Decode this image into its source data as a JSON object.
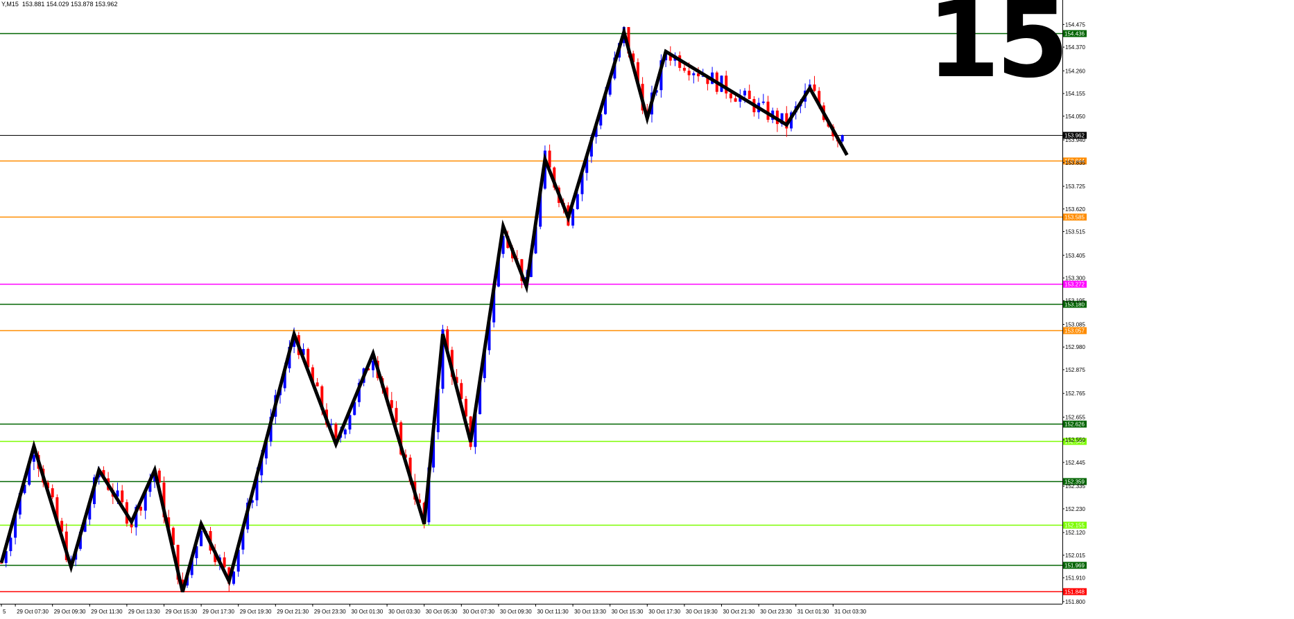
{
  "header": {
    "symbol_timeframe": "Y,M15",
    "ohlc": "153.881 154.029 153.878 153.962"
  },
  "overlay_number": "15",
  "chart_data": {
    "type": "candlestick",
    "title": "",
    "xlabel": "",
    "ylabel": "",
    "ylim": [
      151.79,
      154.55
    ],
    "grid": false,
    "colors": {
      "up": "#0000ff",
      "down": "#ff0000",
      "background": "#ffffff",
      "axis": "#000000",
      "zigzag": "#000000"
    },
    "y_ticks": [
      "154.475",
      "154.370",
      "154.260",
      "154.155",
      "154.050",
      "153.940",
      "153.835",
      "153.725",
      "153.620",
      "153.515",
      "153.405",
      "153.300",
      "153.195",
      "153.085",
      "152.980",
      "152.875",
      "152.765",
      "152.655",
      "152.550",
      "152.445",
      "152.335",
      "152.230",
      "152.120",
      "152.015",
      "151.910",
      "151.800"
    ],
    "x_ticks": [
      "5",
      "29 Oct 07:30",
      "29 Oct 09:30",
      "29 Oct 11:30",
      "29 Oct 13:30",
      "29 Oct 15:30",
      "29 Oct 17:30",
      "29 Oct 19:30",
      "29 Oct 21:30",
      "29 Oct 23:30",
      "30 Oct 01:30",
      "30 Oct 03:30",
      "30 Oct 05:30",
      "30 Oct 07:30",
      "30 Oct 09:30",
      "30 Oct 11:30",
      "30 Oct 13:30",
      "30 Oct 15:30",
      "30 Oct 17:30",
      "30 Oct 19:30",
      "30 Oct 21:30",
      "30 Oct 23:30",
      "31 Oct 01:30",
      "31 Oct 03:30"
    ],
    "x_tick_index": [
      0,
      3,
      11,
      19,
      27,
      35,
      43,
      51,
      59,
      67,
      75,
      83,
      91,
      99,
      107,
      115,
      123,
      131,
      139,
      147,
      155,
      163,
      171,
      179
    ],
    "current_price": {
      "value": 153.962,
      "label": "153.962",
      "color": "#000000",
      "line_color": "#000000"
    },
    "horizontal_levels": [
      {
        "value": 154.436,
        "label": "154.436",
        "color": "#006400"
      },
      {
        "value": 153.844,
        "label": "153.844",
        "color": "#ff8c00"
      },
      {
        "value": 153.585,
        "label": "153.585",
        "color": "#ff8c00"
      },
      {
        "value": 153.272,
        "label": "153.272",
        "color": "#ff00ff"
      },
      {
        "value": 153.18,
        "label": "153.180",
        "color": "#006400"
      },
      {
        "value": 153.057,
        "label": "153.057",
        "color": "#ff8c00"
      },
      {
        "value": 152.626,
        "label": "152.626",
        "color": "#006400"
      },
      {
        "value": 152.545,
        "label": "152.545",
        "color": "#7cfc00"
      },
      {
        "value": 152.359,
        "label": "152.359",
        "color": "#006400"
      },
      {
        "value": 152.155,
        "label": "152.155",
        "color": "#7cfc00"
      },
      {
        "value": 151.969,
        "label": "151.969",
        "color": "#006400"
      },
      {
        "value": 151.848,
        "label": "151.848",
        "color": "#ff0000"
      }
    ],
    "zigzag": [
      {
        "i": 0,
        "price": 151.98
      },
      {
        "i": 7,
        "price": 152.52
      },
      {
        "i": 15,
        "price": 151.96
      },
      {
        "i": 21,
        "price": 152.41
      },
      {
        "i": 28,
        "price": 152.17
      },
      {
        "i": 33,
        "price": 152.41
      },
      {
        "i": 39,
        "price": 151.845
      },
      {
        "i": 43,
        "price": 152.16
      },
      {
        "i": 49,
        "price": 151.895
      },
      {
        "i": 63,
        "price": 153.04
      },
      {
        "i": 72,
        "price": 152.53
      },
      {
        "i": 80,
        "price": 152.95
      },
      {
        "i": 91,
        "price": 152.16
      },
      {
        "i": 95,
        "price": 153.04
      },
      {
        "i": 101,
        "price": 152.54
      },
      {
        "i": 108,
        "price": 153.54
      },
      {
        "i": 113,
        "price": 153.26
      },
      {
        "i": 117,
        "price": 153.85
      },
      {
        "i": 122,
        "price": 153.58
      },
      {
        "i": 134,
        "price": 154.44
      },
      {
        "i": 139,
        "price": 154.04
      },
      {
        "i": 143,
        "price": 154.35
      },
      {
        "i": 169,
        "price": 154.01
      },
      {
        "i": 174,
        "price": 154.18
      },
      {
        "i": 182,
        "price": 153.87
      }
    ]
  }
}
